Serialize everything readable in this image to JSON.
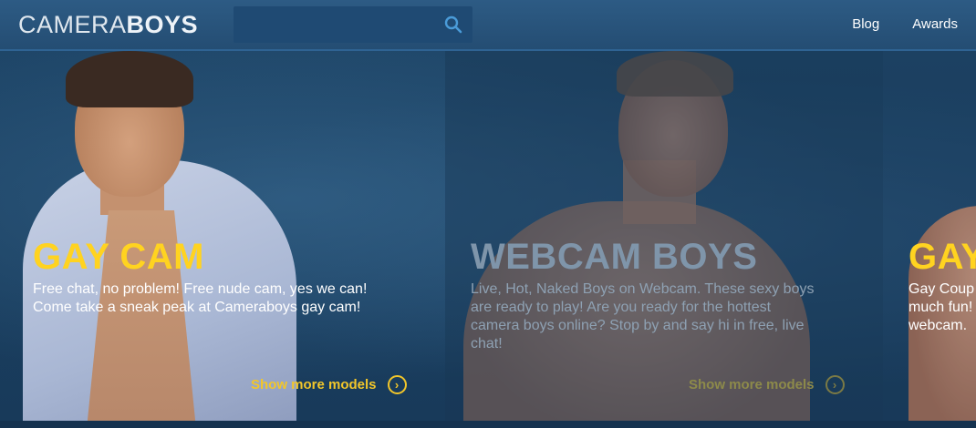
{
  "header": {
    "logo_part1": "CAMERA",
    "logo_part2": "BOYS",
    "search": {
      "placeholder": "",
      "value": "",
      "button_icon": "search-icon"
    },
    "nav": [
      {
        "label": "Blog"
      },
      {
        "label": "Awards"
      }
    ]
  },
  "banner": {
    "slides": [
      {
        "title": "GAY CAM",
        "description_lines": [
          "Free chat, no problem! Free nude cam, yes we can!",
          "Come take a sneak peak at Cameraboys gay cam!"
        ],
        "more_label": "Show more models",
        "more_icon": "chevron-right-circle-icon"
      },
      {
        "title": "WEBCAM BOYS",
        "description_lines": [
          "Live, Hot, Naked Boys on Webcam. These sexy boys",
          "are ready to play! Are you ready for the hottest",
          "camera boys online? Stop by and say hi in free, live",
          "chat!"
        ],
        "more_label": "Show more models",
        "more_icon": "chevron-right-circle-icon"
      },
      {
        "title": "GAY",
        "description_lines": [
          "Gay Coup",
          "much fun!",
          "webcam."
        ]
      }
    ]
  },
  "colors": {
    "accent_yellow": "#ffd320",
    "header_blue": "#2d5b84",
    "background": "#163a5c"
  }
}
